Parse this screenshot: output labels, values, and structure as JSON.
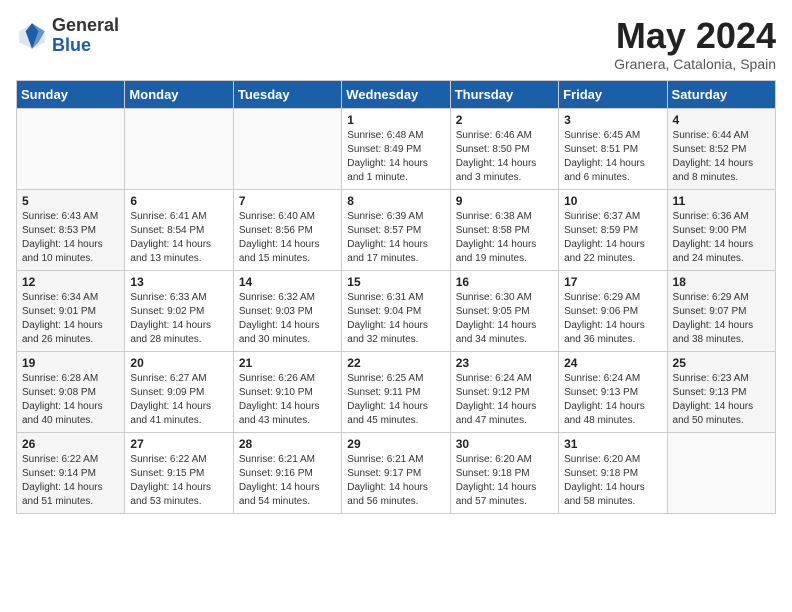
{
  "header": {
    "logo_general": "General",
    "logo_blue": "Blue",
    "month_year": "May 2024",
    "location": "Granera, Catalonia, Spain"
  },
  "days_of_week": [
    "Sunday",
    "Monday",
    "Tuesday",
    "Wednesday",
    "Thursday",
    "Friday",
    "Saturday"
  ],
  "weeks": [
    [
      {
        "day": "",
        "empty": true
      },
      {
        "day": "",
        "empty": true
      },
      {
        "day": "",
        "empty": true
      },
      {
        "day": "1",
        "sunrise": "6:48 AM",
        "sunset": "8:49 PM",
        "daylight": "14 hours and 1 minute."
      },
      {
        "day": "2",
        "sunrise": "6:46 AM",
        "sunset": "8:50 PM",
        "daylight": "14 hours and 3 minutes."
      },
      {
        "day": "3",
        "sunrise": "6:45 AM",
        "sunset": "8:51 PM",
        "daylight": "14 hours and 6 minutes."
      },
      {
        "day": "4",
        "sunrise": "6:44 AM",
        "sunset": "8:52 PM",
        "daylight": "14 hours and 8 minutes.",
        "weekend": true
      }
    ],
    [
      {
        "day": "5",
        "sunrise": "6:43 AM",
        "sunset": "8:53 PM",
        "daylight": "14 hours and 10 minutes.",
        "weekend": true
      },
      {
        "day": "6",
        "sunrise": "6:41 AM",
        "sunset": "8:54 PM",
        "daylight": "14 hours and 13 minutes."
      },
      {
        "day": "7",
        "sunrise": "6:40 AM",
        "sunset": "8:56 PM",
        "daylight": "14 hours and 15 minutes."
      },
      {
        "day": "8",
        "sunrise": "6:39 AM",
        "sunset": "8:57 PM",
        "daylight": "14 hours and 17 minutes."
      },
      {
        "day": "9",
        "sunrise": "6:38 AM",
        "sunset": "8:58 PM",
        "daylight": "14 hours and 19 minutes."
      },
      {
        "day": "10",
        "sunrise": "6:37 AM",
        "sunset": "8:59 PM",
        "daylight": "14 hours and 22 minutes."
      },
      {
        "day": "11",
        "sunrise": "6:36 AM",
        "sunset": "9:00 PM",
        "daylight": "14 hours and 24 minutes.",
        "weekend": true
      }
    ],
    [
      {
        "day": "12",
        "sunrise": "6:34 AM",
        "sunset": "9:01 PM",
        "daylight": "14 hours and 26 minutes.",
        "weekend": true
      },
      {
        "day": "13",
        "sunrise": "6:33 AM",
        "sunset": "9:02 PM",
        "daylight": "14 hours and 28 minutes."
      },
      {
        "day": "14",
        "sunrise": "6:32 AM",
        "sunset": "9:03 PM",
        "daylight": "14 hours and 30 minutes."
      },
      {
        "day": "15",
        "sunrise": "6:31 AM",
        "sunset": "9:04 PM",
        "daylight": "14 hours and 32 minutes."
      },
      {
        "day": "16",
        "sunrise": "6:30 AM",
        "sunset": "9:05 PM",
        "daylight": "14 hours and 34 minutes."
      },
      {
        "day": "17",
        "sunrise": "6:29 AM",
        "sunset": "9:06 PM",
        "daylight": "14 hours and 36 minutes."
      },
      {
        "day": "18",
        "sunrise": "6:29 AM",
        "sunset": "9:07 PM",
        "daylight": "14 hours and 38 minutes.",
        "weekend": true
      }
    ],
    [
      {
        "day": "19",
        "sunrise": "6:28 AM",
        "sunset": "9:08 PM",
        "daylight": "14 hours and 40 minutes.",
        "weekend": true
      },
      {
        "day": "20",
        "sunrise": "6:27 AM",
        "sunset": "9:09 PM",
        "daylight": "14 hours and 41 minutes."
      },
      {
        "day": "21",
        "sunrise": "6:26 AM",
        "sunset": "9:10 PM",
        "daylight": "14 hours and 43 minutes."
      },
      {
        "day": "22",
        "sunrise": "6:25 AM",
        "sunset": "9:11 PM",
        "daylight": "14 hours and 45 minutes."
      },
      {
        "day": "23",
        "sunrise": "6:24 AM",
        "sunset": "9:12 PM",
        "daylight": "14 hours and 47 minutes."
      },
      {
        "day": "24",
        "sunrise": "6:24 AM",
        "sunset": "9:13 PM",
        "daylight": "14 hours and 48 minutes."
      },
      {
        "day": "25",
        "sunrise": "6:23 AM",
        "sunset": "9:13 PM",
        "daylight": "14 hours and 50 minutes.",
        "weekend": true
      }
    ],
    [
      {
        "day": "26",
        "sunrise": "6:22 AM",
        "sunset": "9:14 PM",
        "daylight": "14 hours and 51 minutes.",
        "weekend": true
      },
      {
        "day": "27",
        "sunrise": "6:22 AM",
        "sunset": "9:15 PM",
        "daylight": "14 hours and 53 minutes."
      },
      {
        "day": "28",
        "sunrise": "6:21 AM",
        "sunset": "9:16 PM",
        "daylight": "14 hours and 54 minutes."
      },
      {
        "day": "29",
        "sunrise": "6:21 AM",
        "sunset": "9:17 PM",
        "daylight": "14 hours and 56 minutes."
      },
      {
        "day": "30",
        "sunrise": "6:20 AM",
        "sunset": "9:18 PM",
        "daylight": "14 hours and 57 minutes."
      },
      {
        "day": "31",
        "sunrise": "6:20 AM",
        "sunset": "9:18 PM",
        "daylight": "14 hours and 58 minutes."
      },
      {
        "day": "",
        "empty": true,
        "weekend": true
      }
    ]
  ]
}
